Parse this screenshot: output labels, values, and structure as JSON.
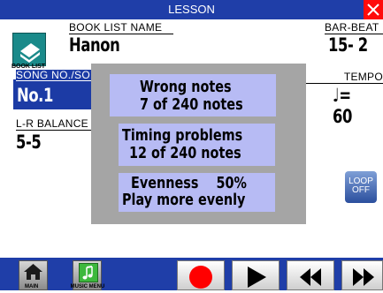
{
  "window": {
    "title": "LESSON"
  },
  "header": {
    "book_list_icon_label": "BOOK LIST",
    "book_list_name_label": "BOOK LIST NAME",
    "book_list_name_value": "Hanon",
    "bar_beat_label": "BAR-BEAT",
    "bar_beat_value": "15- 2"
  },
  "song": {
    "label": "SONG NO./SO",
    "value": "No.1"
  },
  "tempo": {
    "label": "TEMPO",
    "value": "♩= 60"
  },
  "balance": {
    "label": "L-R BALANCE",
    "value": "5-5"
  },
  "dialog": {
    "wrong_notes": {
      "line1": "Wrong notes",
      "line2": "7 of 240 notes"
    },
    "timing": {
      "line1": "Timing problems",
      "line2": "12 of 240 notes"
    },
    "evenness": {
      "line1": "Evenness    50%",
      "line2": "Play more evenly"
    }
  },
  "loop_button": {
    "line1": "LOOP",
    "line2": "OFF"
  },
  "bottom": {
    "main_label": "MAIN",
    "music_menu_label": "MUSIC MENU"
  },
  "colors": {
    "title_bar": "#1f3ea8",
    "close": "#ff0b0b",
    "dialog": "#a5a5a5",
    "message_box": "#b7bbf4",
    "record": "#ff0000"
  }
}
